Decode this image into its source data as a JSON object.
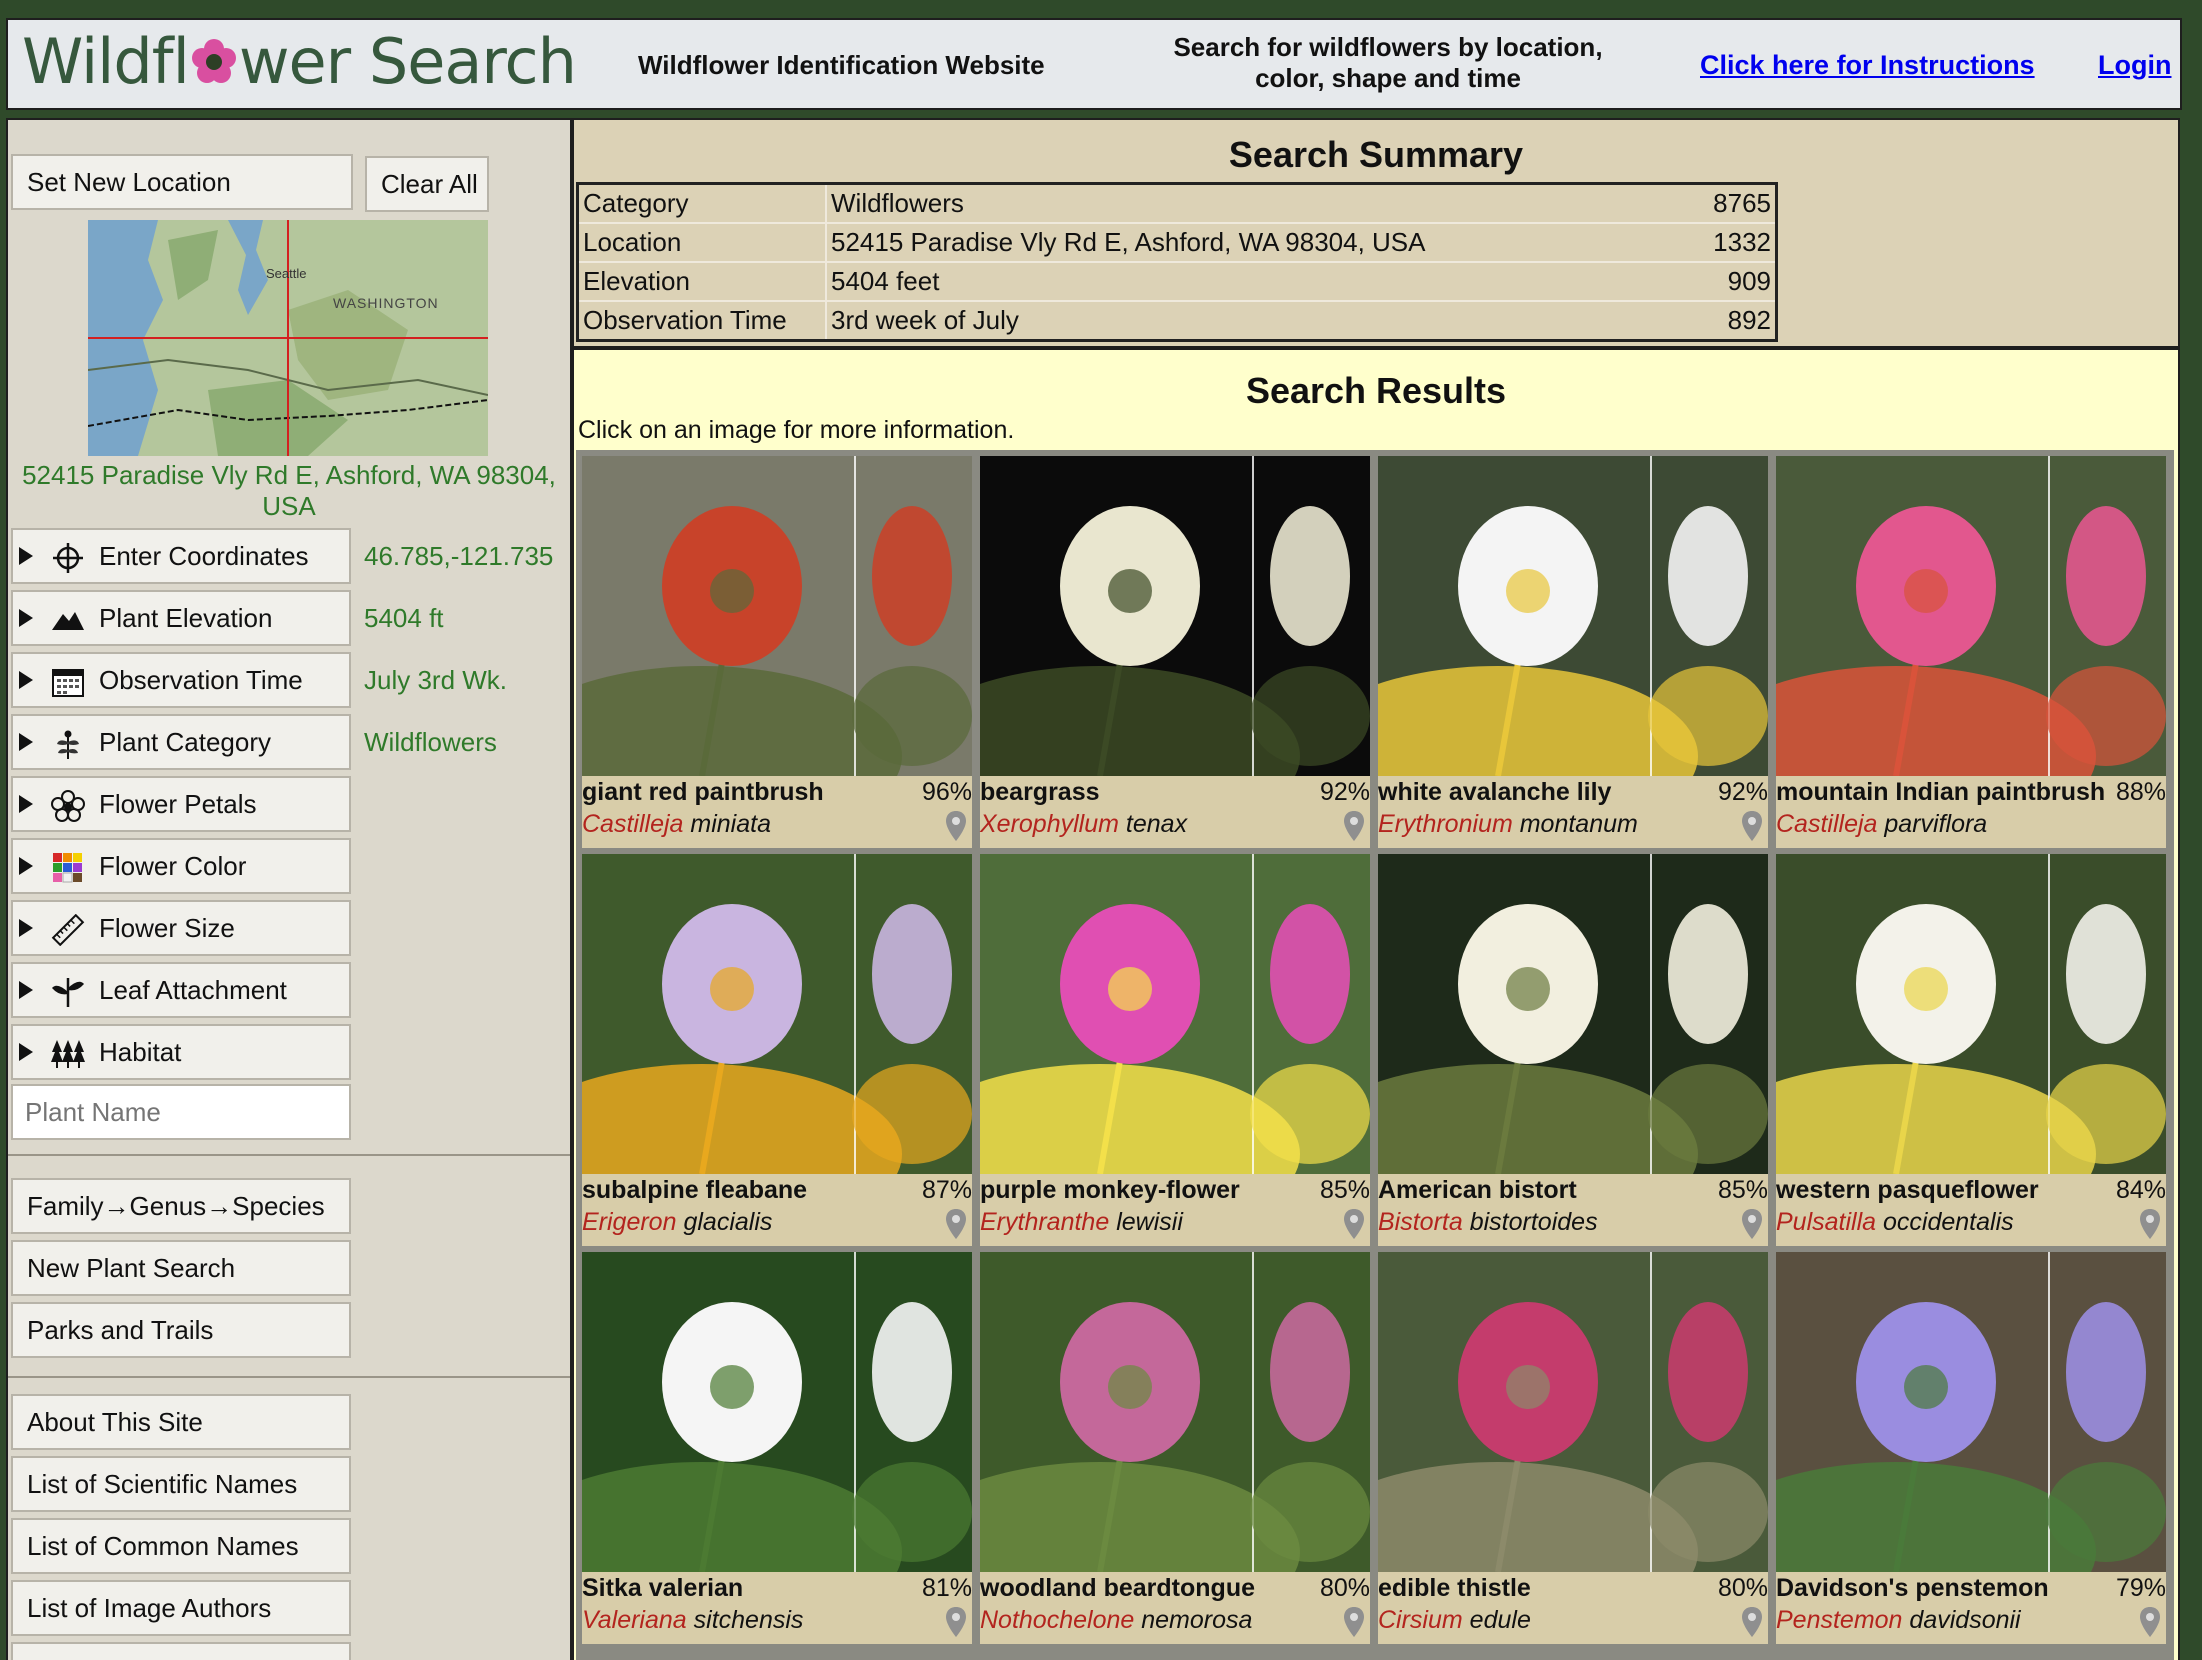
{
  "header": {
    "logo_text_before": "Wildfl",
    "logo_text_after": "wer Search",
    "title": "Wildflower Identification Website",
    "tagline_line1": "Search for wildflowers by location,",
    "tagline_line2": "color, shape and time",
    "instructions_link": "Click here for Instructions",
    "login_link": "Login"
  },
  "sidebar": {
    "set_location": "Set New Location",
    "clear_all": "Clear All",
    "map_labels": {
      "seattle": "Seattle",
      "state": "WASHINGTON"
    },
    "location_text": "52415 Paradise Vly Rd E, Ashford, WA 98304, USA",
    "filters": [
      {
        "label": "Enter Coordinates",
        "value": "46.785,-121.735",
        "icon": "crosshair-icon"
      },
      {
        "label": "Plant Elevation",
        "value": "5404 ft",
        "icon": "mountain-icon"
      },
      {
        "label": "Observation Time",
        "value": "July 3rd Wk.",
        "icon": "calendar-icon"
      },
      {
        "label": "Plant Category",
        "value": "Wildflowers",
        "icon": "plant-icon"
      },
      {
        "label": "Flower Petals",
        "value": "",
        "icon": "petals-icon"
      },
      {
        "label": "Flower Color",
        "value": "",
        "icon": "color-grid-icon"
      },
      {
        "label": "Flower Size",
        "value": "",
        "icon": "ruler-icon"
      },
      {
        "label": "Leaf Attachment",
        "value": "",
        "icon": "leaf-icon"
      },
      {
        "label": "Habitat",
        "value": "",
        "icon": "trees-icon"
      }
    ],
    "plant_name_placeholder": "Plant Name",
    "nav1": [
      "Family→Genus→Species",
      "New Plant Search",
      "Parks and Trails"
    ],
    "nav2": [
      "About This Site",
      "List of Scientific Names",
      "List of Common Names",
      "List of Image Authors"
    ]
  },
  "summary": {
    "title": "Search Summary",
    "rows": [
      {
        "key": "Category",
        "value": "Wildflowers",
        "count": "8765"
      },
      {
        "key": "Location",
        "value": "52415 Paradise Vly Rd E, Ashford, WA 98304, USA",
        "count": "1332"
      },
      {
        "key": "Elevation",
        "value": "5404 feet",
        "count": "909"
      },
      {
        "key": "Observation Time",
        "value": "3rd week of July",
        "count": "892"
      }
    ]
  },
  "results": {
    "title": "Search Results",
    "hint": "Click on an image for more information.",
    "items": [
      {
        "common": "giant red paintbrush",
        "genus": "Castilleja",
        "species": "miniata",
        "pct": "96%",
        "colors": [
          "#7a7a6a",
          "#c8432a",
          "#5a6a3a"
        ]
      },
      {
        "common": "beargrass",
        "genus": "Xerophyllum",
        "species": "tenax",
        "pct": "92%",
        "colors": [
          "#0b0b0b",
          "#e9e6cf",
          "#3c4a25"
        ]
      },
      {
        "common": "white avalanche lily",
        "genus": "Erythronium",
        "species": "montanum",
        "pct": "92%",
        "colors": [
          "#3d4a34",
          "#f4f4f4",
          "#e8c63a"
        ]
      },
      {
        "common": "mountain Indian paintbrush",
        "genus": "Castilleja",
        "species": "parviflora",
        "pct": "88%",
        "colors": [
          "#4a5a3a",
          "#e2578e",
          "#d9533a"
        ]
      },
      {
        "common": "subalpine fleabane",
        "genus": "Erigeron",
        "species": "glacialis",
        "pct": "87%",
        "colors": [
          "#3f5a2c",
          "#c9b5e0",
          "#e8a81e"
        ]
      },
      {
        "common": "purple monkey-flower",
        "genus": "Erythranthe",
        "species": "lewisii",
        "pct": "85%",
        "colors": [
          "#4f6d3a",
          "#e04fb2",
          "#f3e04a"
        ]
      },
      {
        "common": "American bistort",
        "genus": "Bistorta",
        "species": "bistortoides",
        "pct": "85%",
        "colors": [
          "#1e2a1a",
          "#f2efdf",
          "#6b7a3e"
        ]
      },
      {
        "common": "western pasqueflower",
        "genus": "Pulsatilla",
        "species": "occidentalis",
        "pct": "84%",
        "colors": [
          "#3a4d2a",
          "#f3f2ea",
          "#e9d54a"
        ]
      },
      {
        "common": "Sitka valerian",
        "genus": "Valeriana",
        "species": "sitchensis",
        "pct": "81%",
        "colors": [
          "#274a1f",
          "#f5f5f5",
          "#4c7a32"
        ]
      },
      {
        "common": "woodland beardtongue",
        "genus": "Nothochelone",
        "species": "nemorosa",
        "pct": "80%",
        "colors": [
          "#3e5a2a",
          "#c4689a",
          "#6b8a40"
        ]
      },
      {
        "common": "edible thistle",
        "genus": "Cirsium",
        "species": "edule",
        "pct": "80%",
        "colors": [
          "#4a5a3a",
          "#c43c6c",
          "#8c8a6a"
        ]
      },
      {
        "common": "Davidson's penstemon",
        "genus": "Penstemon",
        "species": "davidsonii",
        "pct": "79%",
        "colors": [
          "#5a5040",
          "#9a8de0",
          "#4a7a3a"
        ]
      }
    ]
  }
}
